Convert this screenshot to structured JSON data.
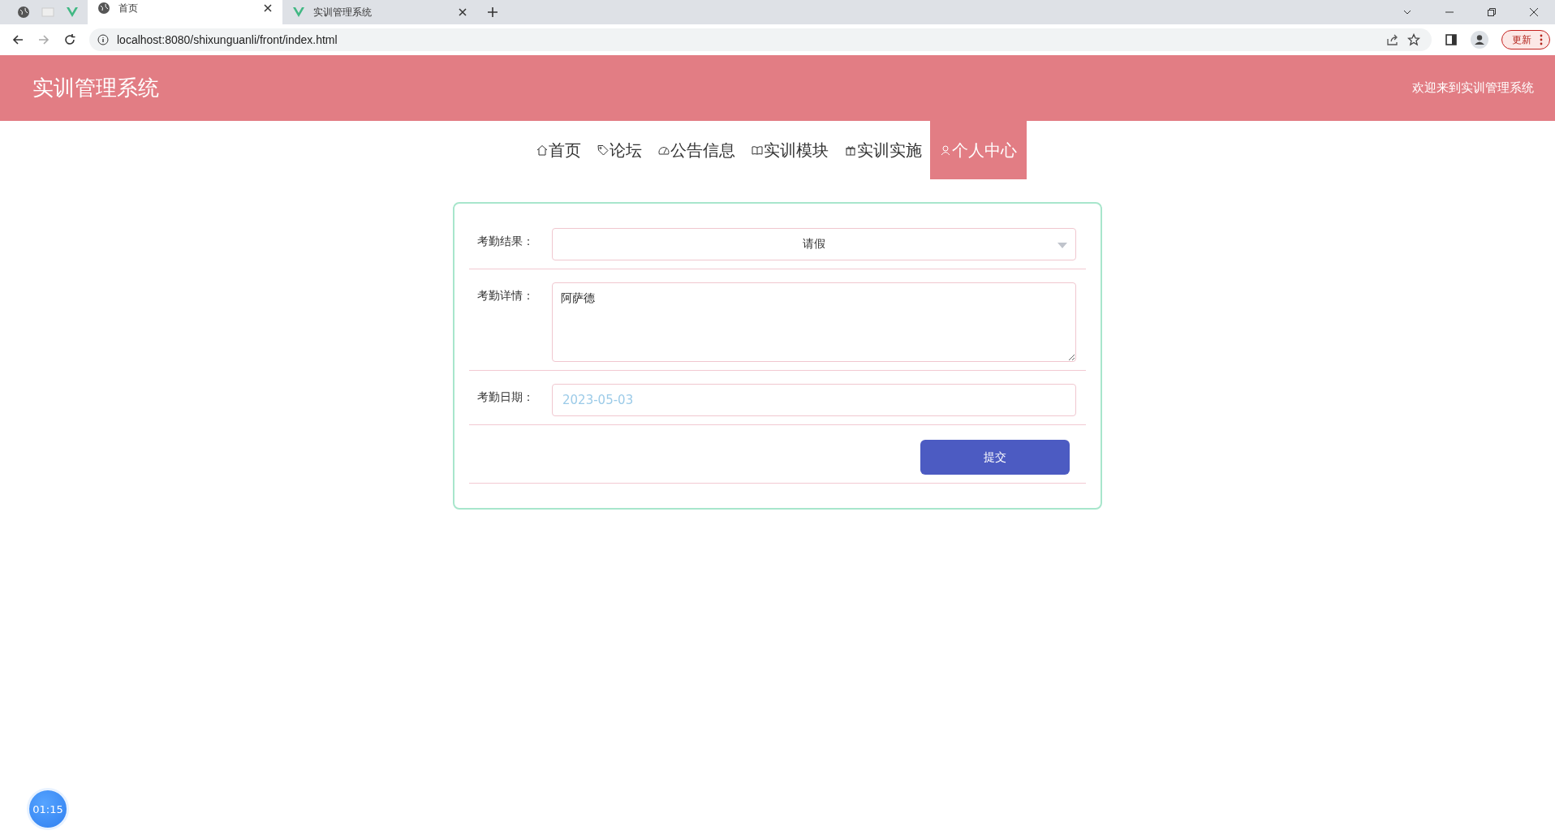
{
  "browser": {
    "tabs": [
      {
        "title": "首页",
        "selected": true
      },
      {
        "title": "实训管理系统",
        "selected": false
      }
    ],
    "url": "localhost:8080/shixunguanli/front/index.html",
    "update_label": "更新"
  },
  "header": {
    "title": "实训管理系统",
    "welcome": "欢迎来到实训管理系统"
  },
  "nav": [
    {
      "label": "首页",
      "selected": false
    },
    {
      "label": "论坛",
      "selected": false
    },
    {
      "label": "公告信息",
      "selected": false
    },
    {
      "label": "实训模块",
      "selected": false
    },
    {
      "label": "实训实施",
      "selected": false
    },
    {
      "label": "个人中心",
      "selected": true
    }
  ],
  "form": {
    "fields": [
      {
        "kind": "select",
        "label": "考勤结果：",
        "value": "请假"
      },
      {
        "kind": "textarea",
        "label": "考勤详情：",
        "value": "阿萨德"
      },
      {
        "kind": "date",
        "label": "考勤日期：",
        "placeholder": "2023-05-03"
      }
    ],
    "submit": "提交"
  },
  "timer": "01:15"
}
